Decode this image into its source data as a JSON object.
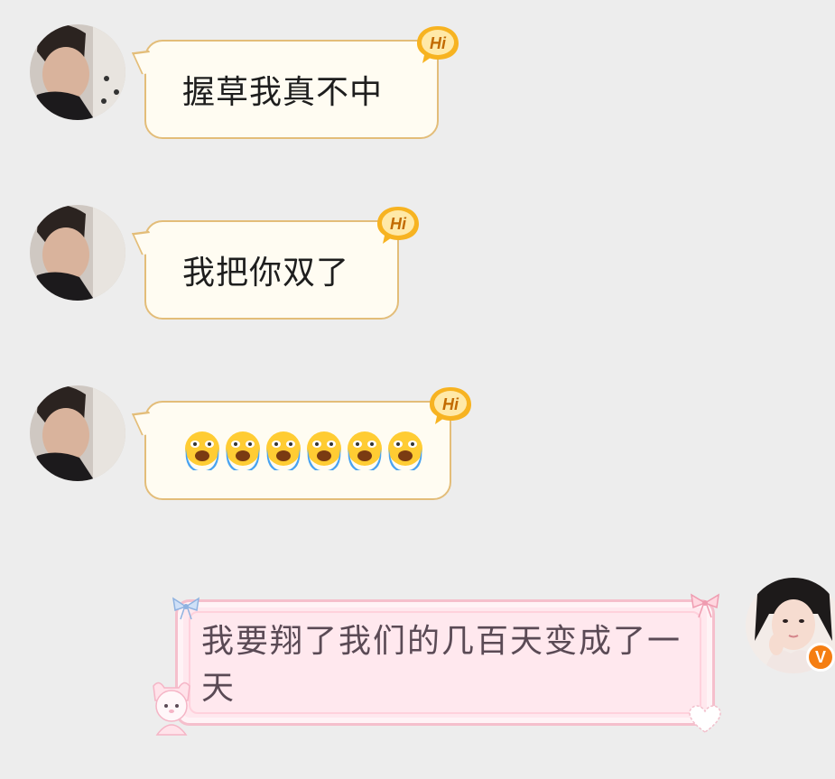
{
  "messages": [
    {
      "sender": "friend",
      "text": "握草我真不中",
      "badge": "Hi"
    },
    {
      "sender": "friend",
      "text": "我把你双了",
      "badge": "Hi"
    },
    {
      "sender": "friend",
      "emoji": [
        "crying-face-emoji",
        "crying-face-emoji",
        "crying-face-emoji",
        "crying-face-emoji",
        "crying-face-emoji",
        "crying-face-emoji"
      ],
      "badge": "Hi"
    },
    {
      "sender": "self",
      "text": "我要翔了我们的几百天变成了一天",
      "badge": "V"
    }
  ],
  "colors": {
    "background": "#ededed",
    "friend_bubble_fill": "#fffcf2",
    "friend_bubble_border": "#e3bd79",
    "self_bubble_fill": "#ffe8ee",
    "self_bubble_border": "#f5bfcc",
    "hi_badge": "#f7b321",
    "verified_badge": "#f57e12"
  }
}
